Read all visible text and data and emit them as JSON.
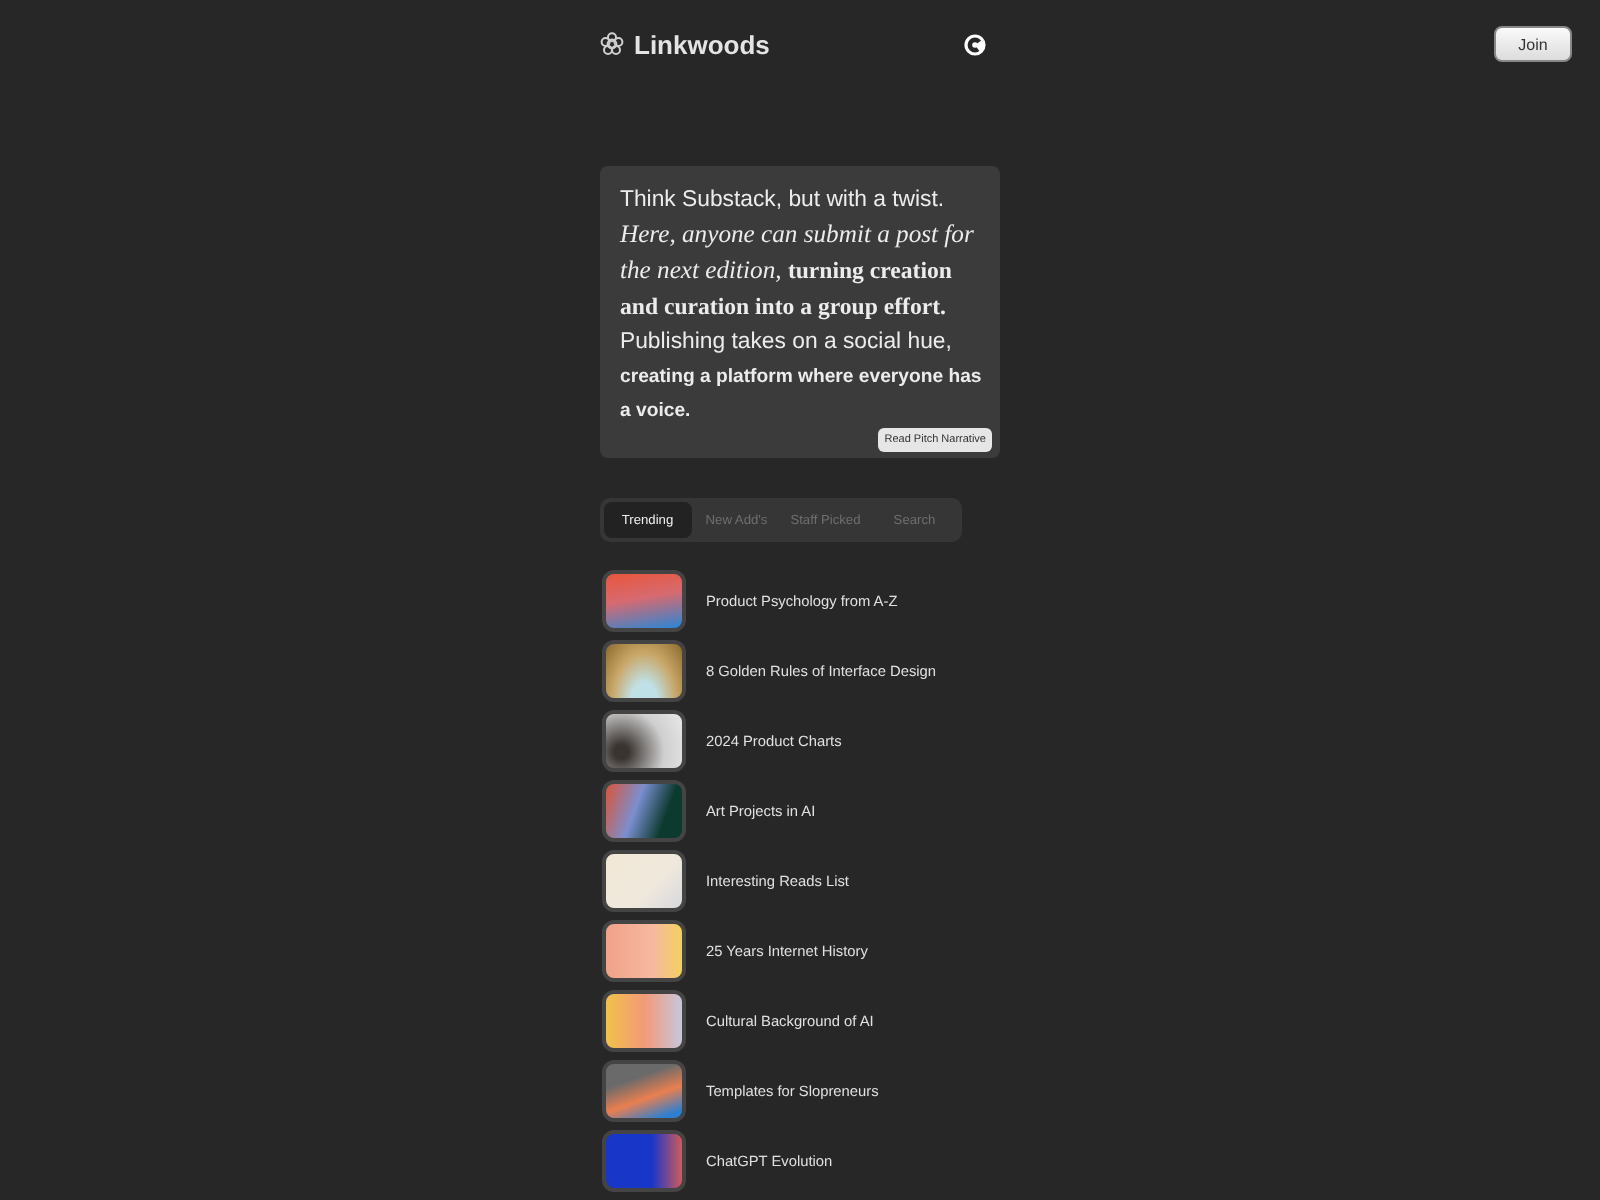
{
  "header": {
    "brand": "Linkwoods",
    "join_button": "Join"
  },
  "pitch": {
    "segments": [
      {
        "kind": "sans",
        "text": "Think Substack, but with a twist. "
      },
      {
        "kind": "serif-italic",
        "text": "Here, anyone can submit a post for the next edition, "
      },
      {
        "kind": "serif-bold",
        "text": "turning creation and curation into a group effort. "
      },
      {
        "kind": "sans",
        "text": "Publishing takes on a social hue, "
      },
      {
        "kind": "hand",
        "text": "creating a platform where everyone has a voice."
      }
    ],
    "button": "Read Pitch Narrative"
  },
  "tabs": [
    {
      "label": "Trending",
      "selected": true
    },
    {
      "label": "New Add's",
      "selected": false
    },
    {
      "label": "Staff Picked",
      "selected": false
    },
    {
      "label": "Search",
      "selected": false
    }
  ],
  "items": [
    {
      "title": "Product Psychology from A-Z"
    },
    {
      "title": "8 Golden Rules of Interface Design"
    },
    {
      "title": "2024 Product Charts"
    },
    {
      "title": "Art Projects in AI"
    },
    {
      "title": "Interesting Reads List"
    },
    {
      "title": "25 Years Internet History"
    },
    {
      "title": "Cultural Background of AI"
    },
    {
      "title": "Templates for Slopreneurs"
    },
    {
      "title": "ChatGPT Evolution"
    }
  ]
}
